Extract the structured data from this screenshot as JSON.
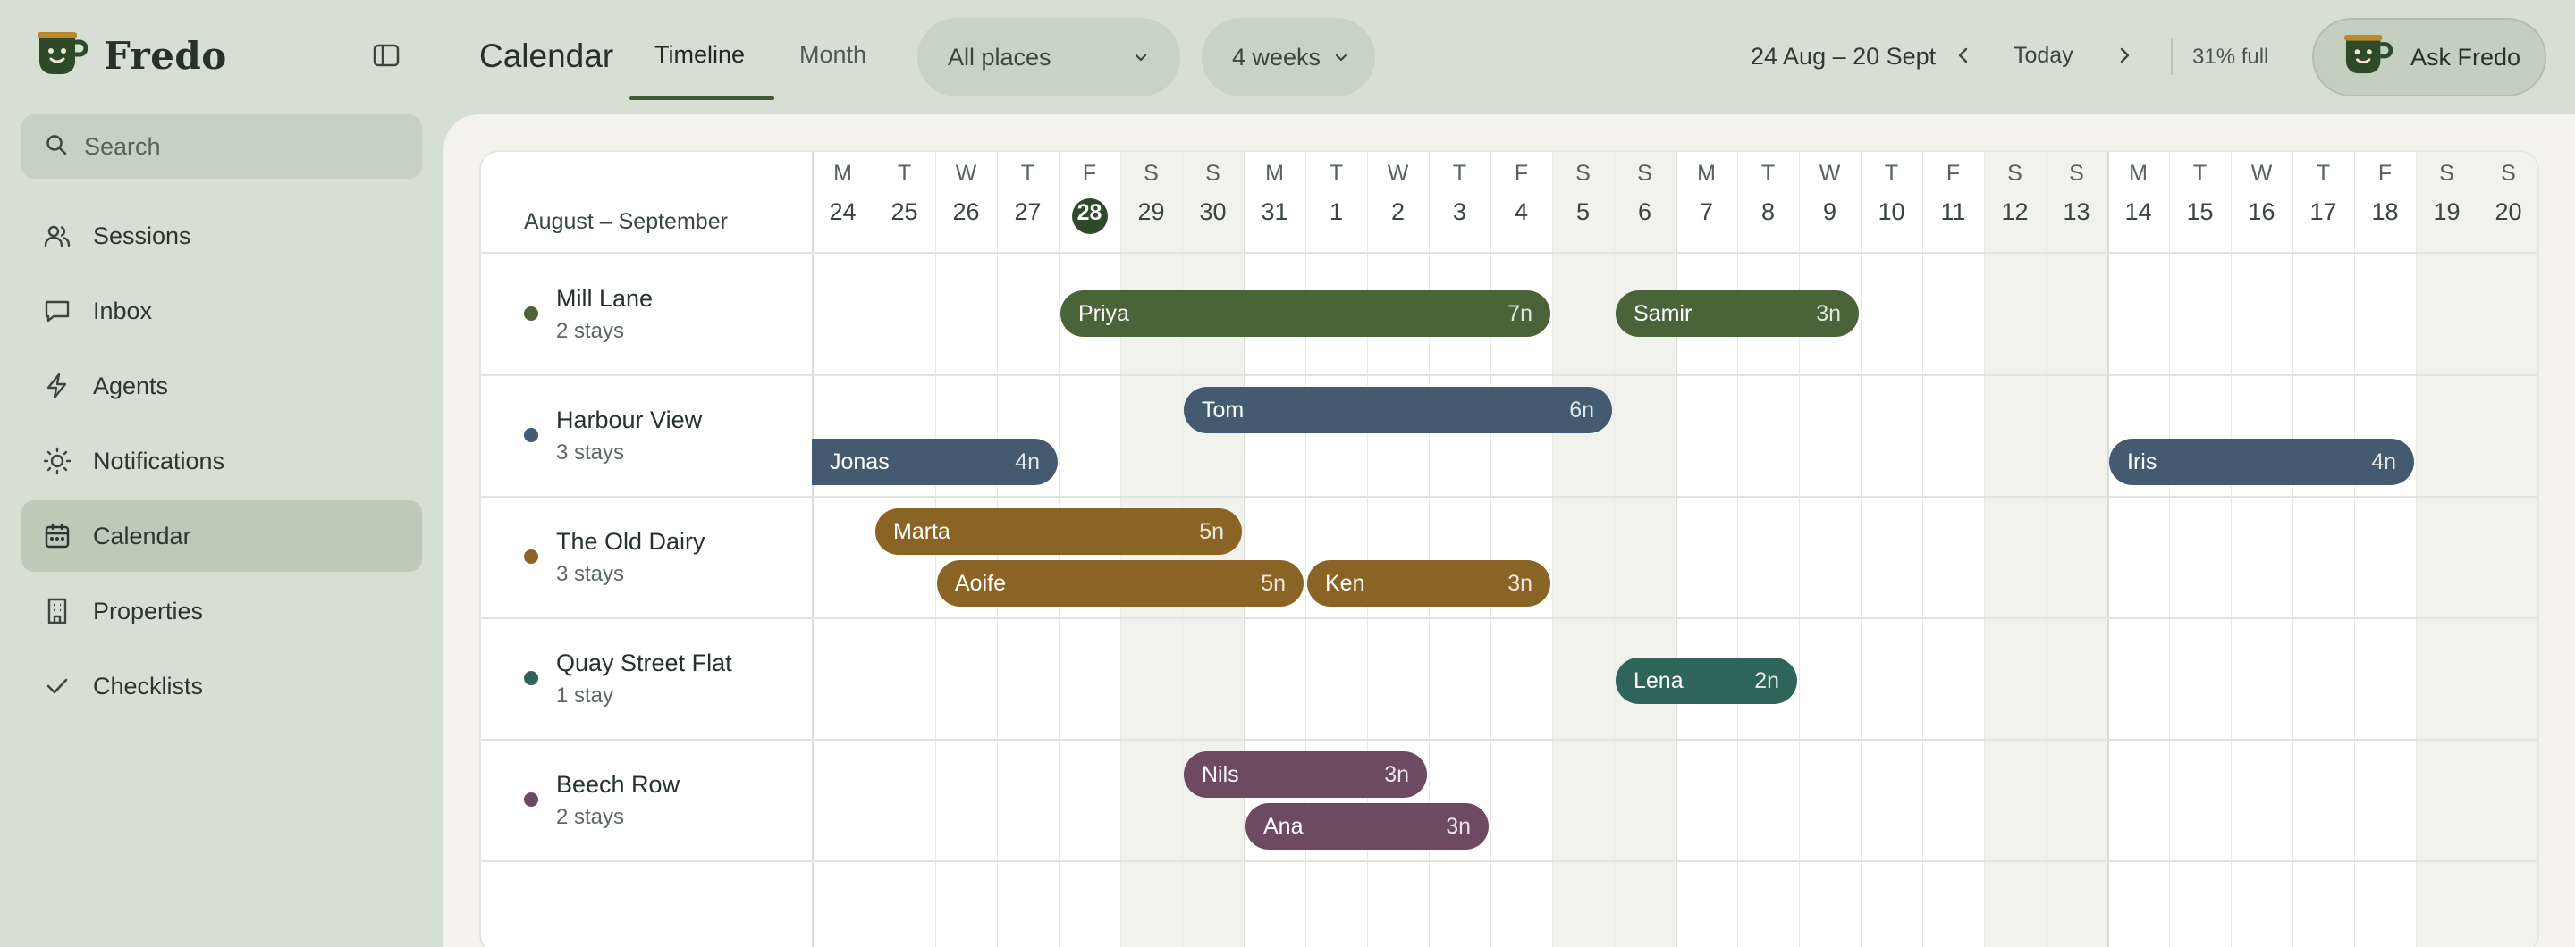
{
  "app": {
    "name": "Fredo"
  },
  "sidebar": {
    "search_placeholder": "Search",
    "items": [
      {
        "label": "Sessions",
        "icon": "users-icon",
        "active": false
      },
      {
        "label": "Inbox",
        "icon": "message-icon",
        "active": false
      },
      {
        "label": "Agents",
        "icon": "lightning-icon",
        "active": false
      },
      {
        "label": "Notifications",
        "icon": "sun-icon",
        "active": false
      },
      {
        "label": "Calendar",
        "icon": "calendar-icon",
        "active": true
      },
      {
        "label": "Properties",
        "icon": "building-icon",
        "active": false
      },
      {
        "label": "Checklists",
        "icon": "check-icon",
        "active": false
      }
    ]
  },
  "header": {
    "title": "Calendar",
    "tabs": [
      {
        "label": "Timeline",
        "active": true
      },
      {
        "label": "Month",
        "active": false
      }
    ],
    "places_filter": "All places",
    "span_filter": "4 weeks",
    "date_range": "24 Aug – 20 Sept",
    "today_label": "Today",
    "occupancy": "31% full",
    "ask_label": "Ask Fredo"
  },
  "calendar": {
    "range_label": "August – September",
    "days": [
      {
        "dow": "M",
        "num": "24"
      },
      {
        "dow": "T",
        "num": "25"
      },
      {
        "dow": "W",
        "num": "26"
      },
      {
        "dow": "T",
        "num": "27"
      },
      {
        "dow": "F",
        "num": "28"
      },
      {
        "dow": "S",
        "num": "29"
      },
      {
        "dow": "S",
        "num": "30"
      },
      {
        "dow": "M",
        "num": "31"
      },
      {
        "dow": "T",
        "num": "1"
      },
      {
        "dow": "W",
        "num": "2"
      },
      {
        "dow": "T",
        "num": "3"
      },
      {
        "dow": "F",
        "num": "4"
      },
      {
        "dow": "S",
        "num": "5"
      },
      {
        "dow": "S",
        "num": "6"
      },
      {
        "dow": "M",
        "num": "7"
      },
      {
        "dow": "T",
        "num": "8"
      },
      {
        "dow": "W",
        "num": "9"
      },
      {
        "dow": "T",
        "num": "10"
      },
      {
        "dow": "F",
        "num": "11"
      },
      {
        "dow": "S",
        "num": "12"
      },
      {
        "dow": "S",
        "num": "13"
      },
      {
        "dow": "M",
        "num": "14"
      },
      {
        "dow": "T",
        "num": "15"
      },
      {
        "dow": "W",
        "num": "16"
      },
      {
        "dow": "T",
        "num": "17"
      },
      {
        "dow": "F",
        "num": "18"
      },
      {
        "dow": "S",
        "num": "19"
      },
      {
        "dow": "S",
        "num": "20"
      }
    ],
    "today_index": 4,
    "properties": [
      {
        "name": "Mill Lane",
        "stays": "2 stays",
        "color": "#4b6338",
        "bookings": [
          {
            "guest": "Priya",
            "nights": "7n",
            "start": 4,
            "length": 8,
            "lane": 0
          },
          {
            "guest": "Samir",
            "nights": "3n",
            "start": 13,
            "length": 4,
            "lane": 0
          }
        ]
      },
      {
        "name": "Harbour View",
        "stays": "3 stays",
        "color": "#445a70",
        "bookings": [
          {
            "guest": "Tom",
            "nights": "6n",
            "start": 6,
            "length": 7,
            "lane": 0
          },
          {
            "guest": "Jonas",
            "nights": "4n",
            "start": 0,
            "length": 4,
            "lane": 1,
            "continues_before": true
          },
          {
            "guest": "Iris",
            "nights": "4n",
            "start": 21,
            "length": 5,
            "lane": 1
          }
        ]
      },
      {
        "name": "The Old Dairy",
        "stays": "3 stays",
        "color": "#8a6425",
        "bookings": [
          {
            "guest": "Marta",
            "nights": "5n",
            "start": 1,
            "length": 6,
            "lane": 0
          },
          {
            "guest": "Aoife",
            "nights": "5n",
            "start": 2,
            "length": 6,
            "lane": 1
          },
          {
            "guest": "Ken",
            "nights": "3n",
            "start": 8,
            "length": 4,
            "lane": 1
          }
        ]
      },
      {
        "name": "Quay Street Flat",
        "stays": "1 stay",
        "color": "#2f6458",
        "bookings": [
          {
            "guest": "Lena",
            "nights": "2n",
            "start": 13,
            "length": 3,
            "lane": 2
          }
        ]
      },
      {
        "name": "Beech Row",
        "stays": "2 stays",
        "color": "#6d4a60",
        "bookings": [
          {
            "guest": "Nils",
            "nights": "3n",
            "start": 6,
            "length": 4,
            "lane": 0
          },
          {
            "guest": "Ana",
            "nights": "3n",
            "start": 7,
            "length": 4,
            "lane": 1
          }
        ]
      }
    ]
  }
}
